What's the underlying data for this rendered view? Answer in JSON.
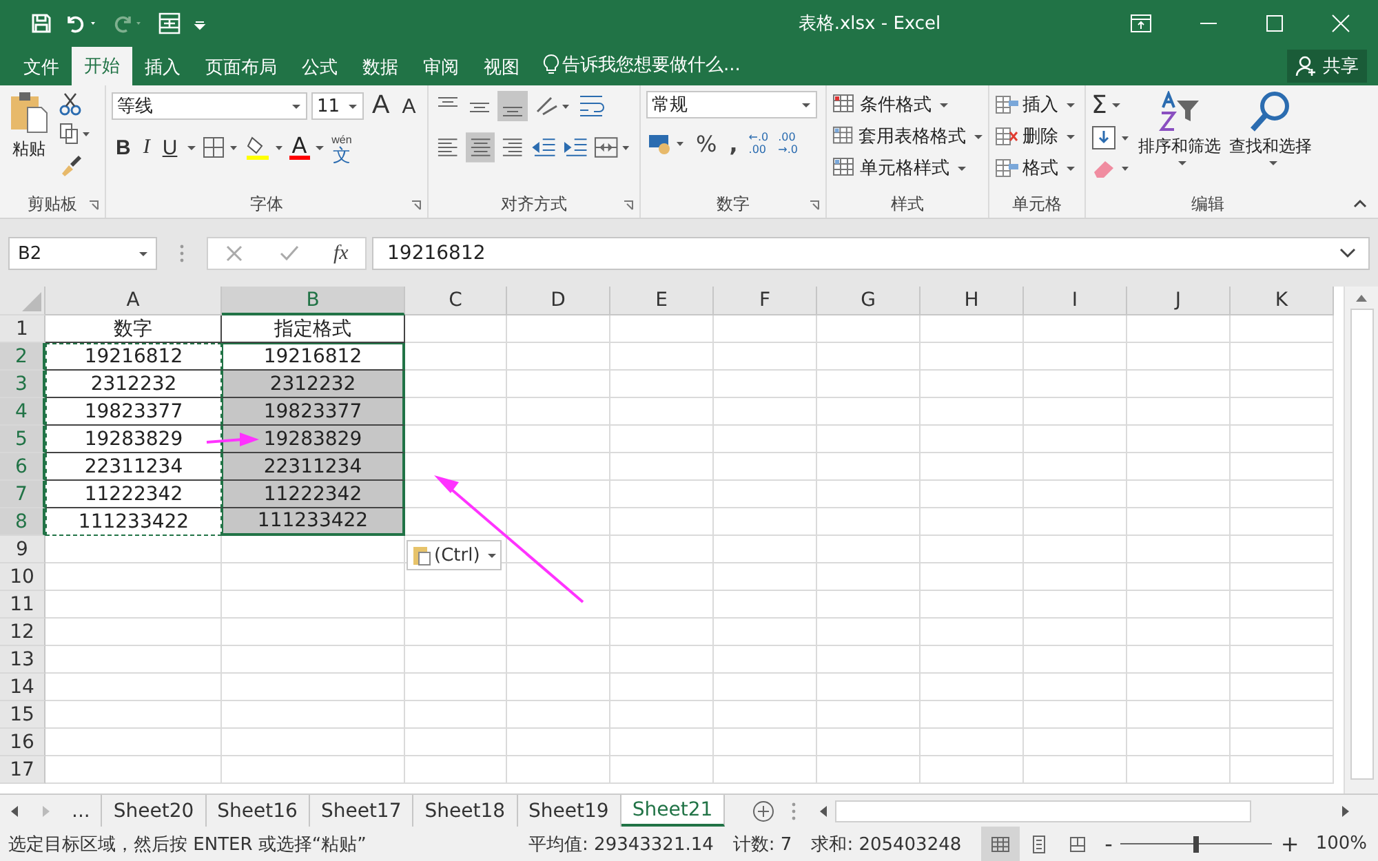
{
  "window": {
    "title": "表格.xlsx - Excel"
  },
  "ribbon_tabs": [
    {
      "label": "文件",
      "selected": false
    },
    {
      "label": "开始",
      "selected": true
    },
    {
      "label": "插入",
      "selected": false
    },
    {
      "label": "页面布局",
      "selected": false
    },
    {
      "label": "公式",
      "selected": false
    },
    {
      "label": "数据",
      "selected": false
    },
    {
      "label": "审阅",
      "selected": false
    },
    {
      "label": "视图",
      "selected": false
    }
  ],
  "tell_me": "告诉我您想要做什么...",
  "share": "共享",
  "clipboard": {
    "paste": "粘贴",
    "label": "剪贴板"
  },
  "font": {
    "name": "等线",
    "size": "11",
    "grow": "A",
    "shrink": "A",
    "bold": "B",
    "italic": "I",
    "underline": "U",
    "font_color": "A",
    "phonetic_top": "wén",
    "phonetic": "文",
    "label": "字体"
  },
  "alignment": {
    "label": "对齐方式"
  },
  "number": {
    "format": "常规",
    "percent": "%",
    "comma": ",",
    "decimal_more": [
      "←.0",
      ".00"
    ],
    "decimal_less": [
      ".00",
      "→.0"
    ],
    "label": "数字"
  },
  "styles": {
    "items": [
      "条件格式",
      "套用表格格式",
      "单元格样式"
    ],
    "label": "样式"
  },
  "cells": {
    "items": [
      "插入",
      "删除",
      "格式"
    ],
    "label": "单元格"
  },
  "editing": {
    "sum": "Σ",
    "sort": "排序和筛选",
    "find": "查找和选择",
    "label": "编辑"
  },
  "formula_bar": {
    "name_box": "B2",
    "fx": "fx",
    "value": "19216812"
  },
  "columns": [
    {
      "label": "A",
      "selected": false
    },
    {
      "label": "B",
      "selected": true
    },
    {
      "label": "C",
      "selected": false
    },
    {
      "label": "D",
      "selected": false
    },
    {
      "label": "E",
      "selected": false
    },
    {
      "label": "F",
      "selected": false
    },
    {
      "label": "G",
      "selected": false
    },
    {
      "label": "H",
      "selected": false
    },
    {
      "label": "I",
      "selected": false
    },
    {
      "label": "J",
      "selected": false
    },
    {
      "label": "K",
      "selected": false
    }
  ],
  "rows": [
    {
      "num": "1",
      "selected": false,
      "a": "数字",
      "b": "指定格式"
    },
    {
      "num": "2",
      "selected": true,
      "a": "19216812",
      "b": "19216812"
    },
    {
      "num": "3",
      "selected": true,
      "a": "2312232",
      "b": "2312232"
    },
    {
      "num": "4",
      "selected": true,
      "a": "19823377",
      "b": "19823377"
    },
    {
      "num": "5",
      "selected": true,
      "a": "19283829",
      "b": "19283829"
    },
    {
      "num": "6",
      "selected": true,
      "a": "22311234",
      "b": "22311234"
    },
    {
      "num": "7",
      "selected": true,
      "a": "11222342",
      "b": "11222342"
    },
    {
      "num": "8",
      "selected": true,
      "a": "111233422",
      "b": "111233422"
    },
    {
      "num": "9",
      "selected": false
    },
    {
      "num": "10",
      "selected": false
    },
    {
      "num": "11",
      "selected": false
    },
    {
      "num": "12",
      "selected": false
    },
    {
      "num": "13",
      "selected": false
    },
    {
      "num": "14",
      "selected": false
    },
    {
      "num": "15",
      "selected": false
    },
    {
      "num": "16",
      "selected": false
    },
    {
      "num": "17",
      "selected": false
    }
  ],
  "paste_options": "(Ctrl)",
  "sheet_tabs": [
    {
      "label": "...",
      "selected": false
    },
    {
      "label": "Sheet20",
      "selected": false
    },
    {
      "label": "Sheet16",
      "selected": false
    },
    {
      "label": "Sheet17",
      "selected": false
    },
    {
      "label": "Sheet18",
      "selected": false
    },
    {
      "label": "Sheet19",
      "selected": false
    },
    {
      "label": "Sheet21",
      "selected": true
    }
  ],
  "status_bar": {
    "message": "选定目标区域，然后按 ENTER 或选择“粘贴”",
    "average": "平均值: 29343321.14",
    "count": "计数: 7",
    "sum": "求和: 205403248",
    "views": [
      {
        "kind": "normal",
        "selected": true
      },
      {
        "kind": "page_layout",
        "selected": false
      },
      {
        "kind": "page_break",
        "selected": false
      }
    ],
    "zoom_out": "-",
    "zoom_in": "+",
    "zoom": {
      "level": 0.5
    },
    "zoom_text": "100%"
  }
}
